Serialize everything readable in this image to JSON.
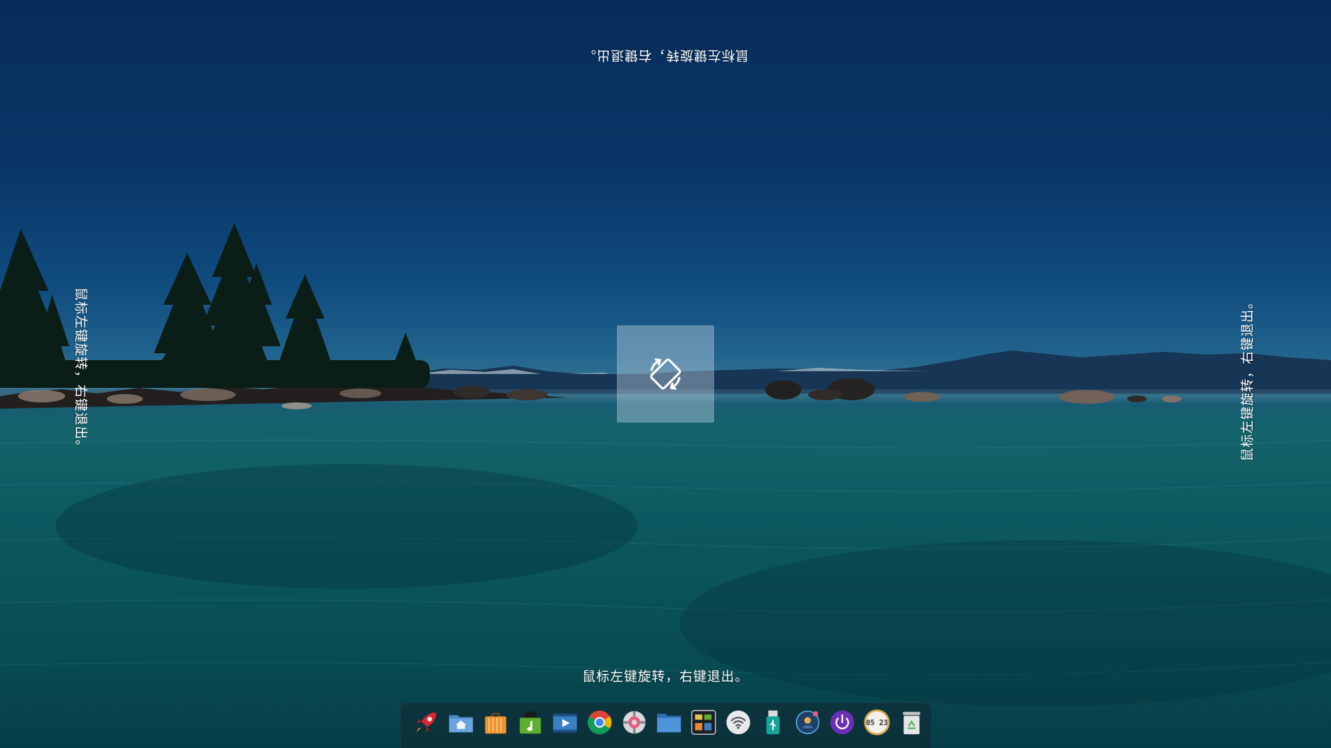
{
  "overlay": {
    "hint_text": "鼠标左键旋转，右键退出。",
    "hint_bottom": "鼠标左键旋转，右键退出。",
    "hint_top": "鼠标左键旋转，右键退出。",
    "hint_left": "鼠标左键旋转，右键退出。",
    "hint_right": "鼠标左键旋转，右键退出。",
    "rotate_icon": "screen-rotation-icon"
  },
  "dock": {
    "items": [
      {
        "icon": "launcher-rocket-icon"
      },
      {
        "icon": "home-folder-icon"
      },
      {
        "icon": "app-store-bag-icon"
      },
      {
        "icon": "music-player-icon"
      },
      {
        "icon": "video-player-icon"
      },
      {
        "icon": "chrome-browser-icon"
      },
      {
        "icon": "settings-gear-icon"
      },
      {
        "icon": "file-manager-folder-icon"
      },
      {
        "icon": "system-monitor-icon"
      },
      {
        "icon": "wifi-icon"
      },
      {
        "icon": "usb-drive-icon"
      },
      {
        "icon": "notification-icon"
      },
      {
        "icon": "power-icon"
      },
      {
        "icon": "clock-icon"
      },
      {
        "icon": "trash-icon"
      }
    ],
    "clock_time": "05 23"
  },
  "colors": {
    "sky_top": "#093468",
    "sea": "#0f6a6e",
    "power_purple": "#6b2fb6",
    "launcher_red": "#d9282f"
  }
}
